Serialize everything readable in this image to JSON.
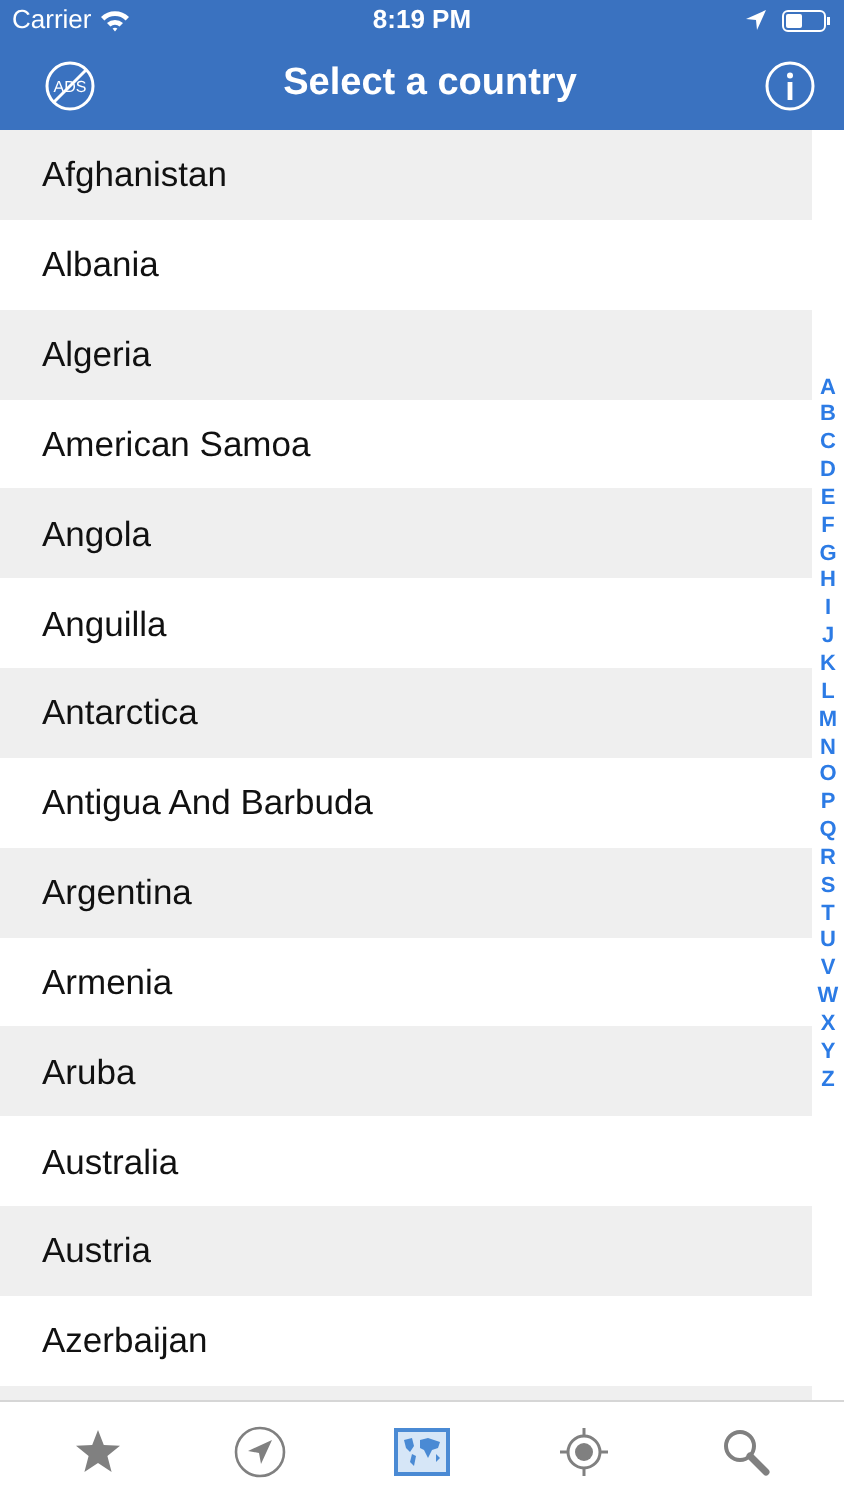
{
  "status_bar": {
    "carrier": "Carrier",
    "time": "8:19 PM"
  },
  "nav_bar": {
    "left_icon_label": "ADS",
    "title": "Select a country"
  },
  "countries": [
    "Afghanistan",
    "Albania",
    "Algeria",
    "American Samoa",
    "Angola",
    "Anguilla",
    "Antarctica",
    "Antigua And Barbuda",
    "Argentina",
    "Armenia",
    "Aruba",
    "Australia",
    "Austria",
    "Azerbaijan"
  ],
  "index_letters": [
    "A",
    "B",
    "C",
    "D",
    "E",
    "F",
    "G",
    "H",
    "I",
    "J",
    "K",
    "L",
    "M",
    "N",
    "O",
    "P",
    "Q",
    "R",
    "S",
    "T",
    "U",
    "V",
    "W",
    "X",
    "Y",
    "Z"
  ],
  "tab_bar": [
    {
      "kind": "star",
      "selected": false
    },
    {
      "kind": "navigation",
      "selected": false
    },
    {
      "kind": "map",
      "selected": true
    },
    {
      "kind": "target",
      "selected": false
    },
    {
      "kind": "search",
      "selected": false
    }
  ]
}
